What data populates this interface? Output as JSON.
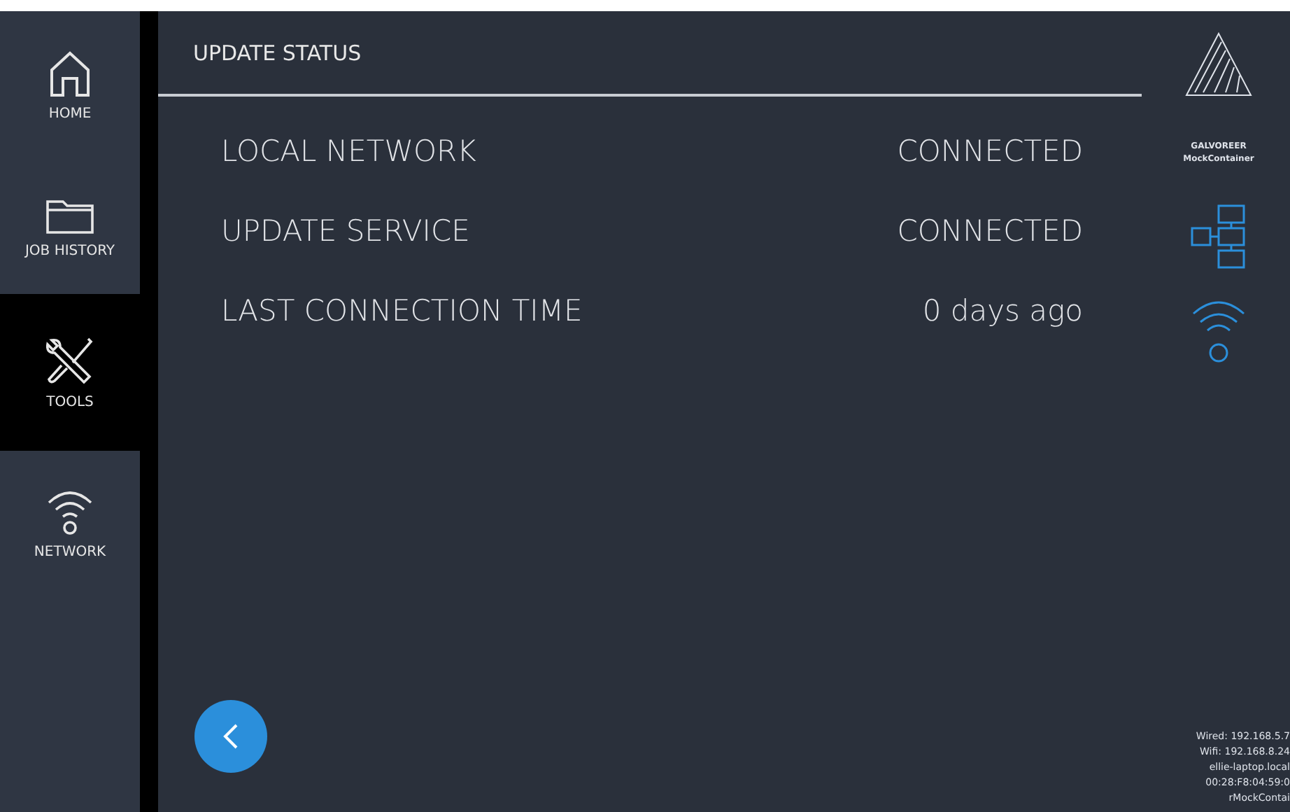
{
  "sidebar": {
    "items": [
      {
        "label": "HOME",
        "selected": false
      },
      {
        "label": "JOB HISTORY",
        "selected": false
      },
      {
        "label": "TOOLS",
        "selected": true
      },
      {
        "label": "NETWORK",
        "selected": false
      }
    ]
  },
  "header": {
    "title": "UPDATE STATUS"
  },
  "status_rows": [
    {
      "label": "LOCAL NETWORK",
      "value": "CONNECTED"
    },
    {
      "label": "UPDATE SERVICE",
      "value": "CONNECTED"
    },
    {
      "label": "LAST CONNECTION TIME",
      "value": "0 days ago"
    }
  ],
  "right_panel": {
    "brand": [
      "GALVOREER",
      "MockContainer"
    ],
    "info": [
      "Wired: 192.168.5.7",
      "Wifi: 192.168.8.24",
      "ellie-laptop.local",
      "00:28:F8:04:59:0",
      "rMockContai"
    ]
  }
}
